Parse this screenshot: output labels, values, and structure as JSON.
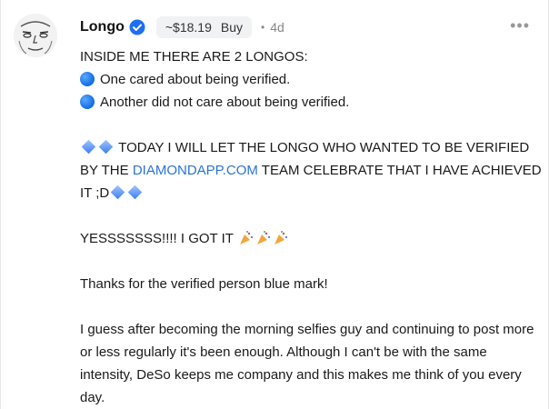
{
  "post": {
    "username": "Longo",
    "coin_price": "~$18.19",
    "buy_label": "Buy",
    "separator": "•",
    "timestamp": "4d",
    "more_icon": "more-horizontal-icon",
    "lines": {
      "line1": "INSIDE ME THERE ARE 2 LONGOS:",
      "line2": "One cared about being verified.",
      "line3": "Another did not care about being verified.",
      "line4": "TODAY I WILL LET THE LONGO WHO WANTED TO BE VERIFIED",
      "line5_pre": "BY THE ",
      "line5_link": "DIAMONDAPP.COM",
      "line5_post": " TEAM CELEBRATE THAT I HAVE ACHIEVED",
      "line6": "IT ;D",
      "line7": "YESSSSSSS!!!! I GOT IT",
      "line8": "Thanks for the verified person blue mark!",
      "para": "I guess after becoming the morning selfies guy and continuing to post more or less regularly it's been enough. Although I can't be with the same intensity, DeSo keeps me company and this makes me think of you every day."
    }
  },
  "colors": {
    "link": "#2b73d9",
    "verified_badge": "#1d6ff2",
    "text": "#1a1a1a",
    "muted": "#888888"
  }
}
